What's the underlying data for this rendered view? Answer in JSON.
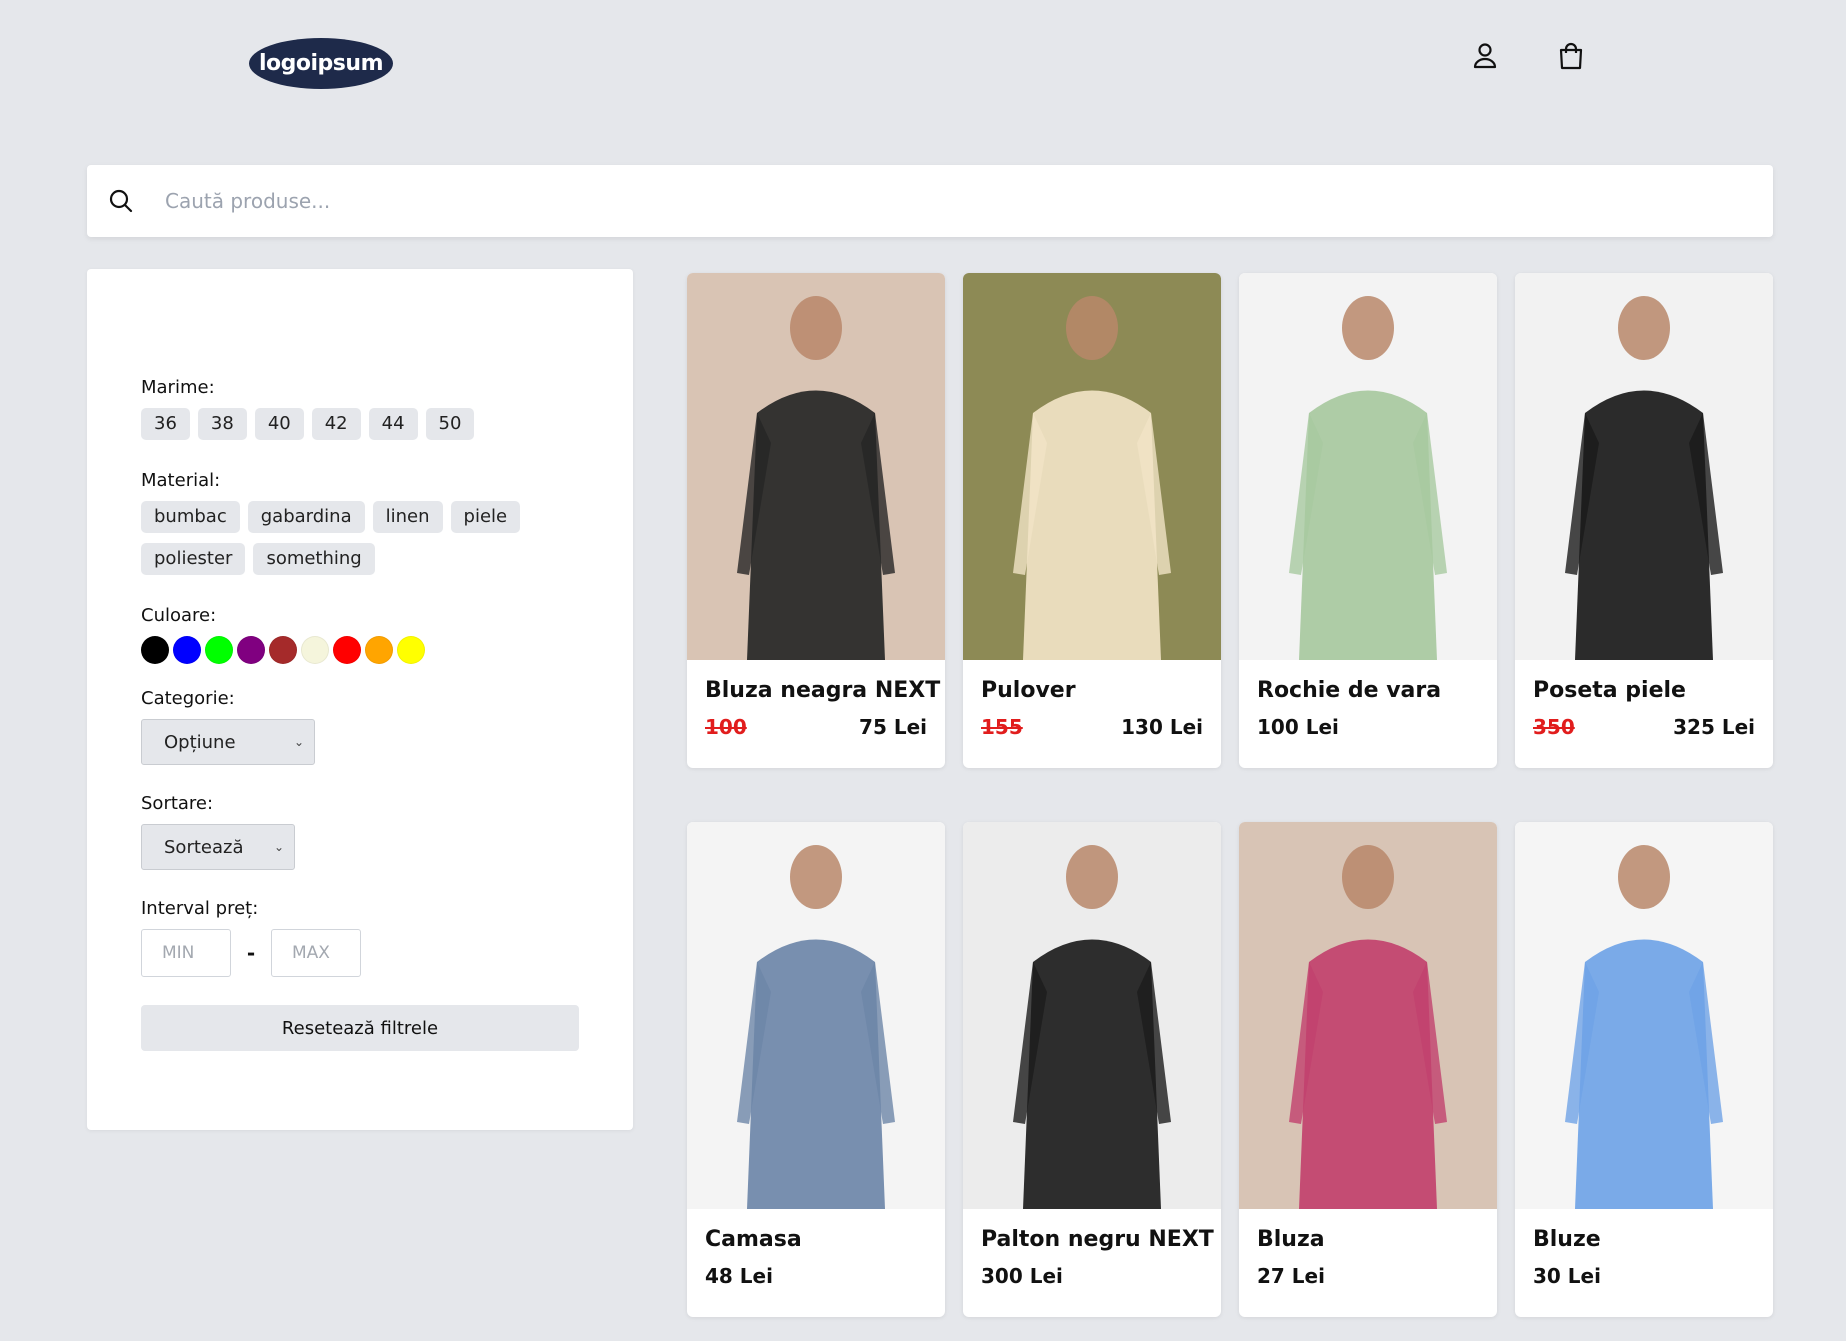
{
  "header": {
    "logo_text": "logoipsum",
    "icons": [
      "user-icon",
      "shopping-bag-icon"
    ]
  },
  "search": {
    "placeholder": "Caută produse..."
  },
  "filters": {
    "size_label": "Marime:",
    "sizes": [
      "36",
      "38",
      "40",
      "42",
      "44",
      "50"
    ],
    "material_label": "Material:",
    "materials": [
      "bumbac",
      "gabardina",
      "linen",
      "piele",
      "poliester",
      "something"
    ],
    "color_label": "Culoare:",
    "colors": [
      "#000000",
      "#0000ff",
      "#00ff00",
      "#800080",
      "#a52a2a",
      "#f5f5dc",
      "#ff0000",
      "#ffa500",
      "#ffff00"
    ],
    "category_label": "Categorie:",
    "category_value": "Opțiune",
    "sort_label": "Sortare:",
    "sort_value": "Sortează",
    "price_label": "Interval preț:",
    "price_min_placeholder": "MIN",
    "price_dash": "-",
    "price_max_placeholder": "MAX",
    "reset_label": "Resetează filtrele"
  },
  "products": [
    {
      "name": "Bluza neagra NEXT",
      "old_price": "100",
      "price": "75 Lei",
      "bg": "#d9c4b4",
      "accent": "#262626"
    },
    {
      "name": "Pulover",
      "old_price": "155",
      "price": "130 Lei",
      "bg": "#8d8a55",
      "accent": "#f1e3c6"
    },
    {
      "name": "Rochie de vara",
      "old_price": "",
      "price": "100 Lei",
      "bg": "#f3f3f3",
      "accent": "#a8c9a0"
    },
    {
      "name": "Poseta piele",
      "old_price": "350",
      "price": "325 Lei",
      "bg": "#f2f2f2",
      "accent": "#1a1a1a"
    },
    {
      "name": "Camasa",
      "old_price": "",
      "price": "48 Lei",
      "bg": "#f4f4f4",
      "accent": "#6d86a8"
    },
    {
      "name": "Palton negru NEXT",
      "old_price": "",
      "price": "300 Lei",
      "bg": "#ececec",
      "accent": "#1c1c1c"
    },
    {
      "name": "Bluza",
      "old_price": "",
      "price": "27 Lei",
      "bg": "#d8c4b5",
      "accent": "#c2416e"
    },
    {
      "name": "Bluze",
      "old_price": "",
      "price": "30 Lei",
      "bg": "#f5f5f5",
      "accent": "#6fa3e6"
    }
  ]
}
